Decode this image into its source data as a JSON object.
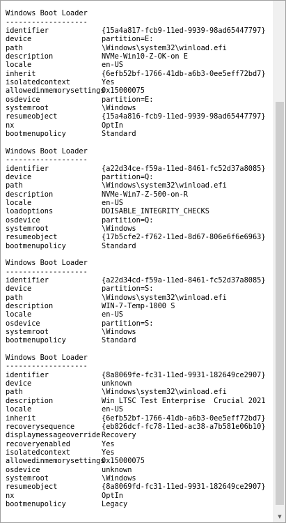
{
  "loaders": [
    {
      "header": "Windows Boot Loader",
      "separator": "-------------------",
      "entries": [
        {
          "key": "identifier",
          "value": "{15a4a817-fcb9-11ed-9939-98ad65447797}"
        },
        {
          "key": "device",
          "value": "partition=E:"
        },
        {
          "key": "path",
          "value": "\\Windows\\system32\\winload.efi"
        },
        {
          "key": "description",
          "value": "NVMe-Win10-Z-OK-on E"
        },
        {
          "key": "locale",
          "value": "en-US"
        },
        {
          "key": "inherit",
          "value": "{6efb52bf-1766-41db-a6b3-0ee5eff72bd7}"
        },
        {
          "key": "isolatedcontext",
          "value": "Yes"
        },
        {
          "key": "allowedinmemorysettings",
          "value": "0x15000075"
        },
        {
          "key": "osdevice",
          "value": "partition=E:"
        },
        {
          "key": "systemroot",
          "value": "\\Windows"
        },
        {
          "key": "resumeobject",
          "value": "{15a4a816-fcb9-11ed-9939-98ad65447797}"
        },
        {
          "key": "nx",
          "value": "OptIn"
        },
        {
          "key": "bootmenupolicy",
          "value": "Standard"
        }
      ]
    },
    {
      "header": "Windows Boot Loader",
      "separator": "-------------------",
      "entries": [
        {
          "key": "identifier",
          "value": "{a22d34ce-f59a-11ed-8461-fc52d37a8085}"
        },
        {
          "key": "device",
          "value": "partition=Q:"
        },
        {
          "key": "path",
          "value": "\\Windows\\system32\\winload.efi"
        },
        {
          "key": "description",
          "value": "NVMe-Win7-Z-500-on-R"
        },
        {
          "key": "locale",
          "value": "en-US"
        },
        {
          "key": "loadoptions",
          "value": "DDISABLE_INTEGRITY_CHECKS"
        },
        {
          "key": "osdevice",
          "value": "partition=Q:"
        },
        {
          "key": "systemroot",
          "value": "\\Windows"
        },
        {
          "key": "resumeobject",
          "value": "{17b5cfe2-f762-11ed-8d67-806e6f6e6963}"
        },
        {
          "key": "bootmenupolicy",
          "value": "Standard"
        }
      ]
    },
    {
      "header": "Windows Boot Loader",
      "separator": "-------------------",
      "entries": [
        {
          "key": "identifier",
          "value": "{a22d34cd-f59a-11ed-8461-fc52d37a8085}"
        },
        {
          "key": "device",
          "value": "partition=S:"
        },
        {
          "key": "path",
          "value": "\\Windows\\system32\\winload.efi"
        },
        {
          "key": "description",
          "value": "WIN-7-Temp-1000 S"
        },
        {
          "key": "locale",
          "value": "en-US"
        },
        {
          "key": "osdevice",
          "value": "partition=S:"
        },
        {
          "key": "systemroot",
          "value": "\\Windows"
        },
        {
          "key": "bootmenupolicy",
          "value": "Standard"
        }
      ]
    },
    {
      "header": "Windows Boot Loader",
      "separator": "-------------------",
      "entries": [
        {
          "key": "identifier",
          "value": "{8a8069fe-fc31-11ed-9931-182649ce2907}"
        },
        {
          "key": "device",
          "value": "unknown"
        },
        {
          "key": "path",
          "value": "\\Windows\\system32\\winload.efi"
        },
        {
          "key": "description",
          "value": "Win LTSC Test Enterprise  Crucial 2021"
        },
        {
          "key": "locale",
          "value": "en-US"
        },
        {
          "key": "inherit",
          "value": "{6efb52bf-1766-41db-a6b3-0ee5eff72bd7}"
        },
        {
          "key": "recoverysequence",
          "value": "{eb826dcf-fc78-11ed-ac38-a7b581e06b10}"
        },
        {
          "key": "displaymessageoverride",
          "value": "Recovery"
        },
        {
          "key": "recoveryenabled",
          "value": "Yes"
        },
        {
          "key": "isolatedcontext",
          "value": "Yes"
        },
        {
          "key": "allowedinmemorysettings",
          "value": "0x15000075"
        },
        {
          "key": "osdevice",
          "value": "unknown"
        },
        {
          "key": "systemroot",
          "value": "\\Windows"
        },
        {
          "key": "resumeobject",
          "value": "{8a8069fd-fc31-11ed-9931-182649ce2907}"
        },
        {
          "key": "nx",
          "value": "OptIn"
        },
        {
          "key": "bootmenupolicy",
          "value": "Legacy"
        }
      ]
    }
  ],
  "scrollbar": {
    "arrow_icon": "chevron-down-icon",
    "position_fraction": 0.2
  }
}
